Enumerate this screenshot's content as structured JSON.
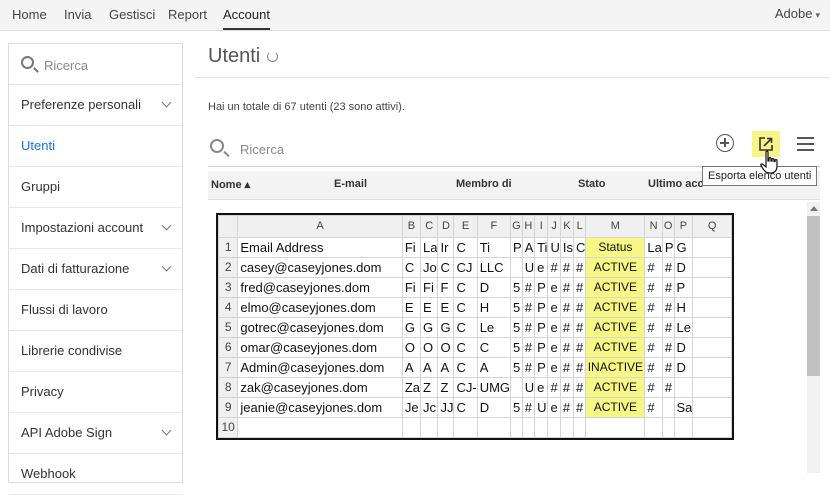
{
  "topnav": {
    "items": [
      "Home",
      "Invia",
      "Gestisci",
      "Report",
      "Account"
    ],
    "active": "Account",
    "brand": "Adobe"
  },
  "sidebar": {
    "search_placeholder": "Ricerca",
    "items": [
      {
        "label": "Preferenze personali",
        "chevron": true
      },
      {
        "label": "Utenti",
        "chevron": false,
        "active": true
      },
      {
        "label": "Gruppi",
        "chevron": false
      },
      {
        "label": "Impostazioni account",
        "chevron": true
      },
      {
        "label": "Dati di fatturazione",
        "chevron": true
      },
      {
        "label": "Flussi di lavoro",
        "chevron": false
      },
      {
        "label": "Librerie condivise",
        "chevron": false
      },
      {
        "label": "Privacy",
        "chevron": false
      },
      {
        "label": "API Adobe Sign",
        "chevron": true
      },
      {
        "label": "Webhook",
        "chevron": false
      }
    ]
  },
  "main": {
    "title": "Utenti",
    "summary": "Hai un totale di 67 utenti (23 sono attivi).",
    "search_placeholder": "Ricerca",
    "tooltip": "Esporta elenco utenti",
    "columns": [
      "Nome ▴",
      "E-mail",
      "Membro di",
      "Stato",
      "Ultimo acc"
    ],
    "icons": {
      "add": "add-circle-icon",
      "export": "export-icon",
      "menu": "hamburger-menu-icon",
      "refresh": "refresh-icon"
    }
  },
  "spreadsheet": {
    "column_letters": [
      "A",
      "B",
      "C",
      "D",
      "E",
      "F",
      "G",
      "H",
      "I",
      "J",
      "K",
      "L",
      "M",
      "N",
      "O",
      "P",
      "Q"
    ],
    "rows": [
      {
        "n": "1",
        "cells": [
          "Email Address",
          "Fi",
          "La",
          "Ir",
          "C",
          "Ti",
          "P",
          "A",
          "Ti",
          "U",
          "Is",
          "C",
          "Status",
          "La",
          "P",
          "G",
          ""
        ]
      },
      {
        "n": "2",
        "cells": [
          "casey@caseyjones.dom",
          "C",
          "Jo",
          "C",
          "CJ",
          "LLC",
          "",
          "U",
          "e",
          "#",
          "#",
          "#",
          "ACTIVE",
          "#",
          "#",
          "D",
          ""
        ]
      },
      {
        "n": "3",
        "cells": [
          "fred@caseyjones.dom",
          "Fi",
          "Fi",
          "F",
          "C",
          "D",
          "5",
          "#",
          "P",
          "e",
          "#",
          "#",
          "ACTIVE",
          "#",
          "#",
          "P",
          ""
        ]
      },
      {
        "n": "4",
        "cells": [
          "elmo@caseyjones.dom",
          "E",
          "E",
          "E",
          "C",
          "H",
          "5",
          "#",
          "P",
          "e",
          "#",
          "#",
          "ACTIVE",
          "#",
          "#",
          "H",
          ""
        ]
      },
      {
        "n": "5",
        "cells": [
          "gotrec@caseyjones.dom",
          "G",
          "G",
          "G",
          "C",
          "Le",
          "5",
          "#",
          "P",
          "e",
          "#",
          "#",
          "ACTIVE",
          "#",
          "#",
          "Le",
          ""
        ]
      },
      {
        "n": "6",
        "cells": [
          "omar@caseyjones.dom",
          "O",
          "O",
          "O",
          "C",
          "C",
          "5",
          "#",
          "P",
          "e",
          "#",
          "#",
          "ACTIVE",
          "#",
          "#",
          "D",
          ""
        ]
      },
      {
        "n": "7",
        "cells": [
          "Admin@caseyjones.dom",
          "A",
          "A",
          "A",
          "C",
          "A",
          "5",
          "#",
          "P",
          "e",
          "#",
          "#",
          "INACTIVE",
          "#",
          "#",
          "D",
          ""
        ]
      },
      {
        "n": "8",
        "cells": [
          "zak@caseyjones.dom",
          "Za",
          "Z",
          "Z",
          "CJ-",
          "UMG",
          "",
          "U",
          "e",
          "#",
          "#",
          "#",
          "ACTIVE",
          "#",
          "#",
          "",
          ""
        ]
      },
      {
        "n": "9",
        "cells": [
          "jeanie@caseyjones.dom",
          "Je",
          "Jc",
          "JJ",
          "C",
          "D",
          "5",
          "#",
          "U",
          "e",
          "#",
          "#",
          "ACTIVE",
          "#",
          "",
          "Sa",
          ""
        ]
      },
      {
        "n": "10",
        "cells": [
          "",
          "",
          "",
          "",
          "",
          "",
          "",
          "",
          "",
          "",
          "",
          "",
          "",
          "",
          "",
          "",
          ""
        ]
      }
    ]
  },
  "colors": {
    "accent": "#1473e6",
    "highlight": "#f7f785"
  }
}
